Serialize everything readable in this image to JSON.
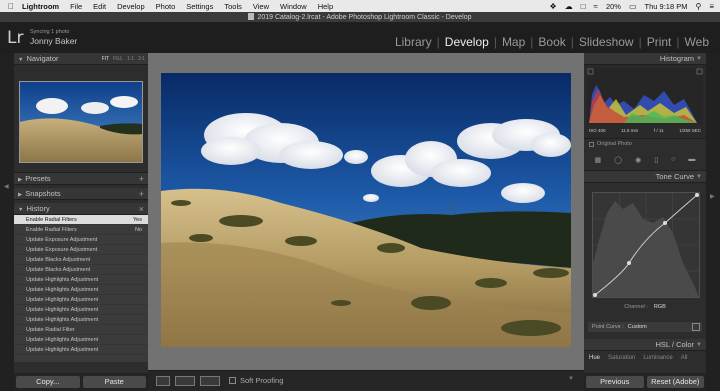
{
  "menubar": {
    "app_name": "Lightroom",
    "items": [
      "File",
      "Edit",
      "Develop",
      "Photo",
      "Settings",
      "Tools",
      "View",
      "Window",
      "Help"
    ],
    "battery": "20%",
    "clock": "Thu 9:18 PM"
  },
  "window": {
    "title": "2019 Catalog-2.lrcat - Adobe Photoshop Lightroom Classic - Develop"
  },
  "identity": {
    "logo": "Lr",
    "sync_status": "Syncing 1 photo",
    "user_name": "Jonny Baker"
  },
  "modules": {
    "items": [
      "Library",
      "Develop",
      "Map",
      "Book",
      "Slideshow",
      "Print",
      "Web"
    ],
    "separator": "|",
    "active": "Develop"
  },
  "left_panel": {
    "navigator": {
      "title": "Navigator",
      "options": [
        "FIT",
        "FILL",
        "1:1",
        "3:1"
      ]
    },
    "presets": {
      "title": "Presets"
    },
    "snapshots": {
      "title": "Snapshots"
    },
    "history": {
      "title": "History",
      "items": [
        {
          "label": "Enable Radial Filters",
          "value": "Yes"
        },
        {
          "label": "Enable Radial Filters",
          "value": "No"
        },
        {
          "label": "Update Exposure Adjustment",
          "value": ""
        },
        {
          "label": "Update Exposure Adjustment",
          "value": ""
        },
        {
          "label": "Update Blacks Adjustment",
          "value": ""
        },
        {
          "label": "Update Blacks Adjustment",
          "value": ""
        },
        {
          "label": "Update Highlights Adjustment",
          "value": ""
        },
        {
          "label": "Update Highlights Adjustment",
          "value": ""
        },
        {
          "label": "Update Highlights Adjustment",
          "value": ""
        },
        {
          "label": "Update Highlights Adjustment",
          "value": ""
        },
        {
          "label": "Update Highlights Adjustment",
          "value": ""
        },
        {
          "label": "Update Radial Filter",
          "value": ""
        },
        {
          "label": "Update Highlights Adjustment",
          "value": ""
        },
        {
          "label": "Update Highlights Adjustment",
          "value": ""
        }
      ]
    },
    "copy_label": "Copy...",
    "paste_label": "Paste"
  },
  "toolbar": {
    "soft_proofing_label": "Soft Proofing"
  },
  "right_panel": {
    "histogram": {
      "title": "Histogram",
      "iso": "ISO 400",
      "focal": "11.5 mm",
      "aperture": "f / 11",
      "shutter": "1/250 SEC",
      "original_photo_label": "Original Photo"
    },
    "tone_curve": {
      "title": "Tone Curve",
      "channel_label": "Channel :",
      "channel_value": "RGB",
      "point_curve_label": "Point Curve :",
      "point_curve_value": "Custom"
    },
    "hsl": {
      "title": "HSL / Color",
      "tabs": [
        "Hue",
        "Saturation",
        "Luminance",
        "All"
      ],
      "active_tab": "Hue"
    },
    "previous_label": "Previous",
    "reset_label": "Reset (Adobe)"
  }
}
